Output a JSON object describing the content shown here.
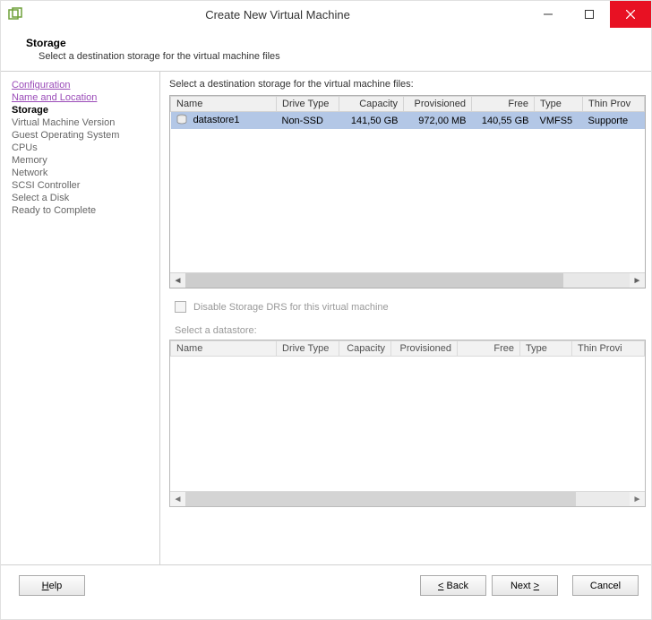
{
  "window": {
    "title": "Create New Virtual Machine"
  },
  "header": {
    "heading": "Storage",
    "subheading": "Select a destination storage for the virtual machine files"
  },
  "sidebar": {
    "items": [
      {
        "label": "Configuration",
        "state": "done"
      },
      {
        "label": "Name and Location",
        "state": "done"
      },
      {
        "label": "Storage",
        "state": "current"
      },
      {
        "label": "Virtual Machine Version",
        "state": "pending"
      },
      {
        "label": "Guest Operating System",
        "state": "pending"
      },
      {
        "label": "CPUs",
        "state": "pending"
      },
      {
        "label": "Memory",
        "state": "pending"
      },
      {
        "label": "Network",
        "state": "pending"
      },
      {
        "label": "SCSI Controller",
        "state": "pending"
      },
      {
        "label": "Select a Disk",
        "state": "pending"
      },
      {
        "label": "Ready to Complete",
        "state": "pending"
      }
    ]
  },
  "main": {
    "prompt": "Select a destination storage for the virtual machine files:",
    "table1": {
      "headers": [
        "Name",
        "Drive Type",
        "Capacity",
        "Provisioned",
        "Free",
        "Type",
        "Thin Prov"
      ],
      "rows": [
        {
          "name": "datastore1",
          "drive_type": "Non-SSD",
          "capacity": "141,50 GB",
          "provisioned": "972,00 MB",
          "free": "140,55 GB",
          "type": "VMFS5",
          "thin": "Supporte"
        }
      ]
    },
    "disable_drs_label": "Disable Storage DRS for this virtual machine",
    "select_datastore_label": "Select a datastore:",
    "table2": {
      "headers": [
        "Name",
        "Drive Type",
        "Capacity",
        "Provisioned",
        "Free",
        "Type",
        "Thin Provi"
      ]
    }
  },
  "footer": {
    "help": "Help",
    "back": "Back",
    "next": "Next",
    "cancel": "Cancel"
  }
}
